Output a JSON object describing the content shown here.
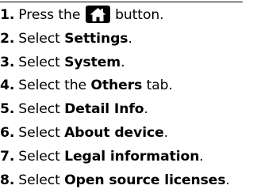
{
  "steps": [
    {
      "number": "1.",
      "before": "Press the",
      "icon": "home-icon",
      "after": "button."
    },
    {
      "number": "2.",
      "before": "Select",
      "bold": "Settings",
      "after": "."
    },
    {
      "number": "3.",
      "before": "Select",
      "bold": "System",
      "after": "."
    },
    {
      "number": "4.",
      "before": "Select the",
      "bold": "Others",
      "after": "tab."
    },
    {
      "number": "5.",
      "before": "Select",
      "bold": "Detail Info",
      "after": "."
    },
    {
      "number": "6.",
      "before": "Select",
      "bold": "About device",
      "after": "."
    },
    {
      "number": "7.",
      "before": "Select",
      "bold": "Legal information",
      "after": "."
    },
    {
      "number": "8.",
      "before": "Select",
      "bold": "Open source licenses",
      "after": "."
    }
  ]
}
